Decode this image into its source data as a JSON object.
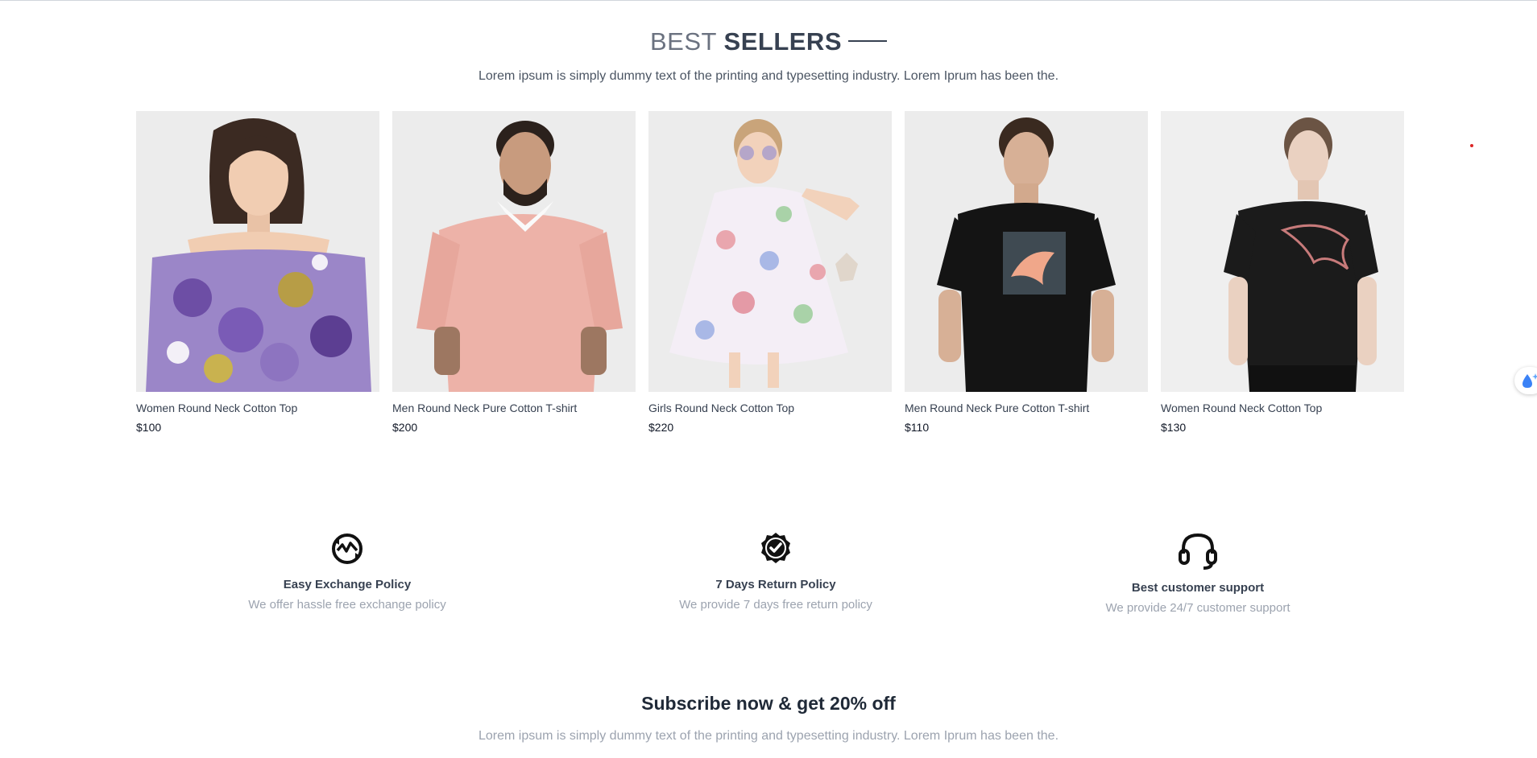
{
  "best_sellers": {
    "title_light": "BEST",
    "title_bold": "SELLERS",
    "subtitle": "Lorem ipsum is simply dummy text of the printing and typesetting industry. Lorem Iprum has been the."
  },
  "products": [
    {
      "name": "Women Round Neck Cotton Top",
      "price": "$100"
    },
    {
      "name": "Men Round Neck Pure Cotton T-shirt",
      "price": "$200"
    },
    {
      "name": "Girls Round Neck Cotton Top",
      "price": "$220"
    },
    {
      "name": "Men Round Neck Pure Cotton T-shirt",
      "price": "$110"
    },
    {
      "name": "Women Round Neck Cotton Top",
      "price": "$130"
    }
  ],
  "features": [
    {
      "icon": "exchange-icon",
      "title": "Easy Exchange Policy",
      "desc": "We offer hassle free exchange policy"
    },
    {
      "icon": "quality-badge-icon",
      "title": "7 Days Return Policy",
      "desc": "We provide 7 days free return policy"
    },
    {
      "icon": "headset-icon",
      "title": "Best customer support",
      "desc": "We provide 24/7 customer support"
    }
  ],
  "subscribe": {
    "title": "Subscribe now & get 20% off",
    "subtitle": "Lorem ipsum is simply dummy text of the printing and typesetting industry. Lorem Iprum has been the."
  },
  "colors": {
    "text_dark": "#374151",
    "text_muted": "#9ca3af",
    "accent_dot": "#dc2626",
    "widget_icon": "#3b82f6"
  }
}
